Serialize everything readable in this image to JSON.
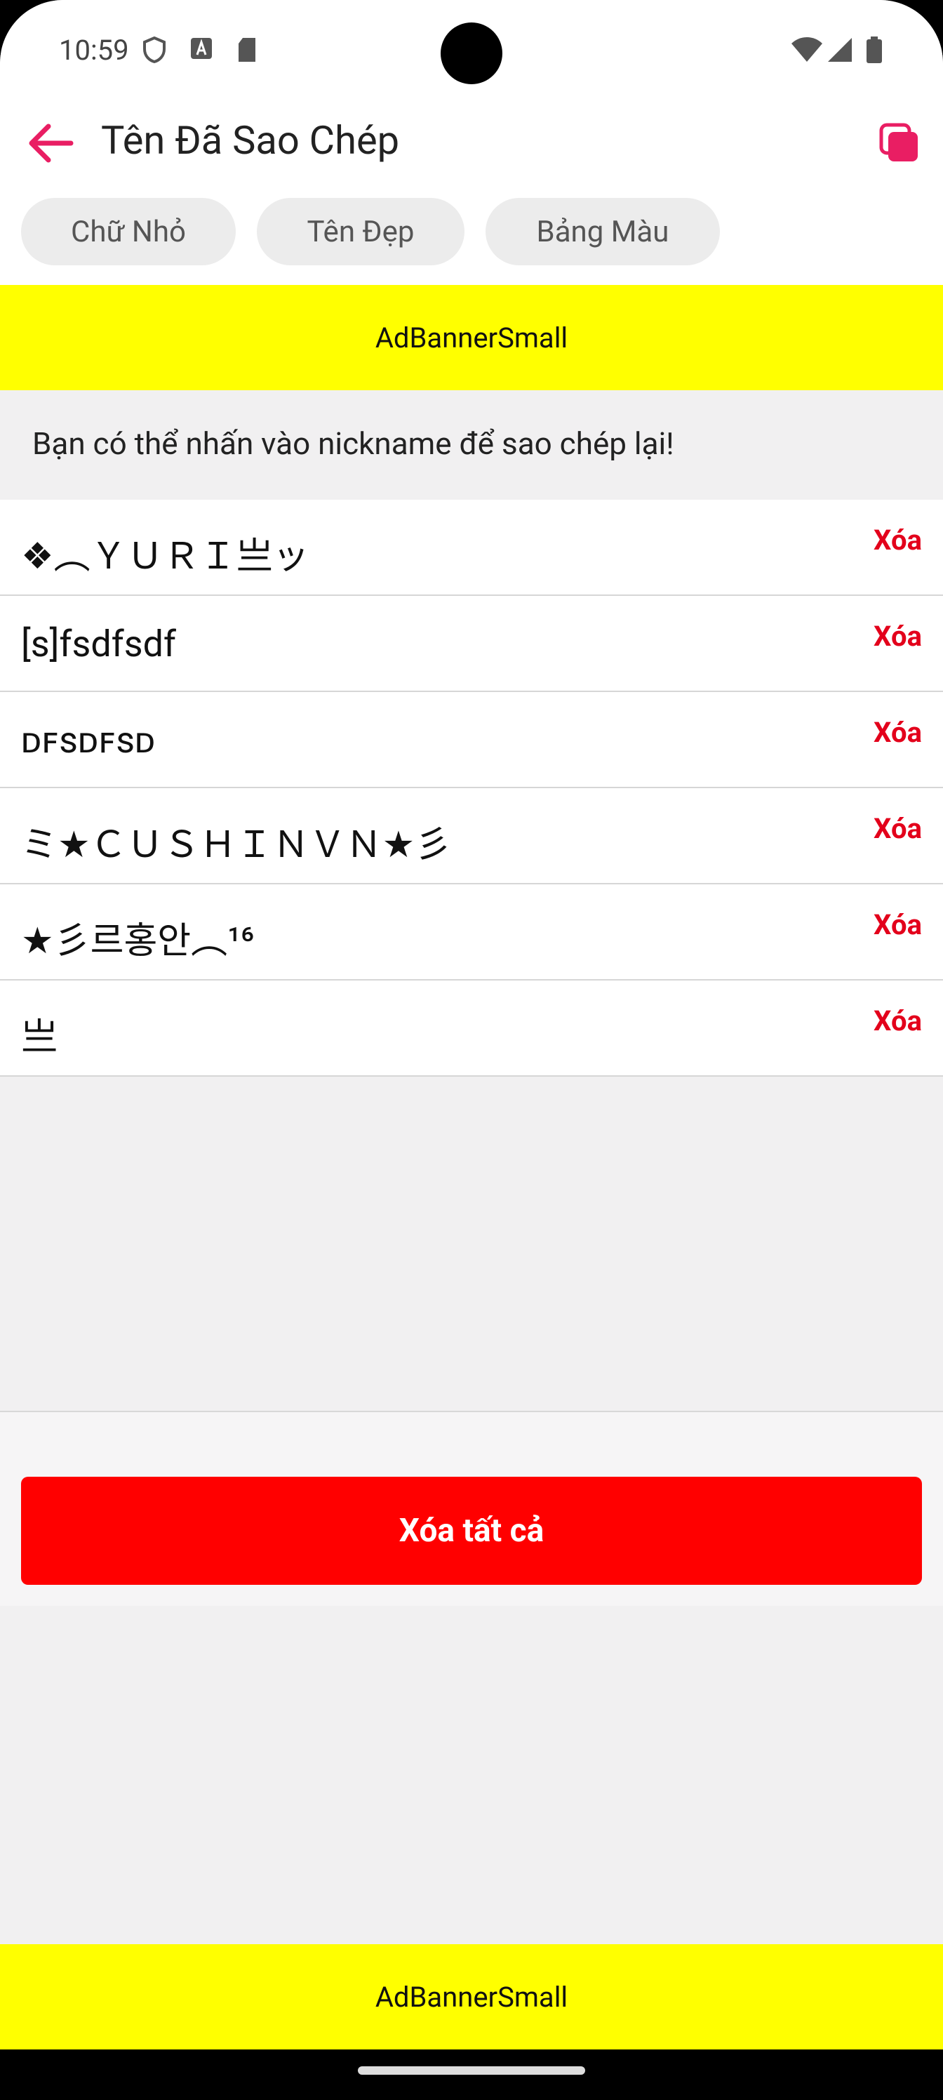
{
  "status": {
    "time": "10:59"
  },
  "app_bar": {
    "title": "Tên Đã Sao Chép"
  },
  "chips": [
    {
      "label": "Chữ Nhỏ"
    },
    {
      "label": "Tên Đẹp"
    },
    {
      "label": "Bảng Màu"
    }
  ],
  "ads": {
    "top": "AdBannerSmall",
    "bottom": "AdBannerSmall"
  },
  "hint": "Bạn có thể nhấn vào nickname để sao chép lại!",
  "list": {
    "delete_label": "Xóa",
    "items": [
      {
        "nickname": "❖︵ＹＵＲＩ亗ッ"
      },
      {
        "nickname": "[s]fsdfsdf"
      },
      {
        "nickname": "ᴅꜰsᴅꜰsᴅ"
      },
      {
        "nickname": "ミ★ＣＵＳＨＩＮＶＮ★彡"
      },
      {
        "nickname": "★彡르홍안︵¹⁶"
      },
      {
        "nickname": "亗"
      }
    ]
  },
  "actions": {
    "clear_all": "Xóa tất cả"
  },
  "colors": {
    "accent": "#e91e63",
    "danger": "#ff0000",
    "ad": "#ffff00"
  }
}
